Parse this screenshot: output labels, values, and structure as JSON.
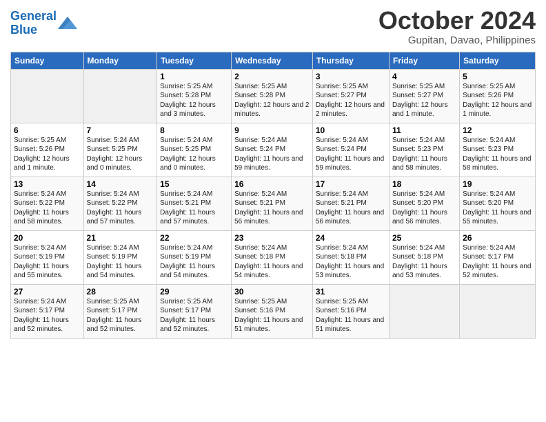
{
  "logo": {
    "line1": "General",
    "line2": "Blue"
  },
  "title": "October 2024",
  "subtitle": "Gupitan, Davao, Philippines",
  "days_of_week": [
    "Sunday",
    "Monday",
    "Tuesday",
    "Wednesday",
    "Thursday",
    "Friday",
    "Saturday"
  ],
  "weeks": [
    [
      {
        "day": "",
        "info": ""
      },
      {
        "day": "",
        "info": ""
      },
      {
        "day": "1",
        "info": "Sunrise: 5:25 AM\nSunset: 5:28 PM\nDaylight: 12 hours and 3 minutes."
      },
      {
        "day": "2",
        "info": "Sunrise: 5:25 AM\nSunset: 5:28 PM\nDaylight: 12 hours and 2 minutes."
      },
      {
        "day": "3",
        "info": "Sunrise: 5:25 AM\nSunset: 5:27 PM\nDaylight: 12 hours and 2 minutes."
      },
      {
        "day": "4",
        "info": "Sunrise: 5:25 AM\nSunset: 5:27 PM\nDaylight: 12 hours and 1 minute."
      },
      {
        "day": "5",
        "info": "Sunrise: 5:25 AM\nSunset: 5:26 PM\nDaylight: 12 hours and 1 minute."
      }
    ],
    [
      {
        "day": "6",
        "info": "Sunrise: 5:25 AM\nSunset: 5:26 PM\nDaylight: 12 hours and 1 minute."
      },
      {
        "day": "7",
        "info": "Sunrise: 5:24 AM\nSunset: 5:25 PM\nDaylight: 12 hours and 0 minutes."
      },
      {
        "day": "8",
        "info": "Sunrise: 5:24 AM\nSunset: 5:25 PM\nDaylight: 12 hours and 0 minutes."
      },
      {
        "day": "9",
        "info": "Sunrise: 5:24 AM\nSunset: 5:24 PM\nDaylight: 11 hours and 59 minutes."
      },
      {
        "day": "10",
        "info": "Sunrise: 5:24 AM\nSunset: 5:24 PM\nDaylight: 11 hours and 59 minutes."
      },
      {
        "day": "11",
        "info": "Sunrise: 5:24 AM\nSunset: 5:23 PM\nDaylight: 11 hours and 58 minutes."
      },
      {
        "day": "12",
        "info": "Sunrise: 5:24 AM\nSunset: 5:23 PM\nDaylight: 11 hours and 58 minutes."
      }
    ],
    [
      {
        "day": "13",
        "info": "Sunrise: 5:24 AM\nSunset: 5:22 PM\nDaylight: 11 hours and 58 minutes."
      },
      {
        "day": "14",
        "info": "Sunrise: 5:24 AM\nSunset: 5:22 PM\nDaylight: 11 hours and 57 minutes."
      },
      {
        "day": "15",
        "info": "Sunrise: 5:24 AM\nSunset: 5:21 PM\nDaylight: 11 hours and 57 minutes."
      },
      {
        "day": "16",
        "info": "Sunrise: 5:24 AM\nSunset: 5:21 PM\nDaylight: 11 hours and 56 minutes."
      },
      {
        "day": "17",
        "info": "Sunrise: 5:24 AM\nSunset: 5:21 PM\nDaylight: 11 hours and 56 minutes."
      },
      {
        "day": "18",
        "info": "Sunrise: 5:24 AM\nSunset: 5:20 PM\nDaylight: 11 hours and 56 minutes."
      },
      {
        "day": "19",
        "info": "Sunrise: 5:24 AM\nSunset: 5:20 PM\nDaylight: 11 hours and 55 minutes."
      }
    ],
    [
      {
        "day": "20",
        "info": "Sunrise: 5:24 AM\nSunset: 5:19 PM\nDaylight: 11 hours and 55 minutes."
      },
      {
        "day": "21",
        "info": "Sunrise: 5:24 AM\nSunset: 5:19 PM\nDaylight: 11 hours and 54 minutes."
      },
      {
        "day": "22",
        "info": "Sunrise: 5:24 AM\nSunset: 5:19 PM\nDaylight: 11 hours and 54 minutes."
      },
      {
        "day": "23",
        "info": "Sunrise: 5:24 AM\nSunset: 5:18 PM\nDaylight: 11 hours and 54 minutes."
      },
      {
        "day": "24",
        "info": "Sunrise: 5:24 AM\nSunset: 5:18 PM\nDaylight: 11 hours and 53 minutes."
      },
      {
        "day": "25",
        "info": "Sunrise: 5:24 AM\nSunset: 5:18 PM\nDaylight: 11 hours and 53 minutes."
      },
      {
        "day": "26",
        "info": "Sunrise: 5:24 AM\nSunset: 5:17 PM\nDaylight: 11 hours and 52 minutes."
      }
    ],
    [
      {
        "day": "27",
        "info": "Sunrise: 5:24 AM\nSunset: 5:17 PM\nDaylight: 11 hours and 52 minutes."
      },
      {
        "day": "28",
        "info": "Sunrise: 5:25 AM\nSunset: 5:17 PM\nDaylight: 11 hours and 52 minutes."
      },
      {
        "day": "29",
        "info": "Sunrise: 5:25 AM\nSunset: 5:17 PM\nDaylight: 11 hours and 52 minutes."
      },
      {
        "day": "30",
        "info": "Sunrise: 5:25 AM\nSunset: 5:16 PM\nDaylight: 11 hours and 51 minutes."
      },
      {
        "day": "31",
        "info": "Sunrise: 5:25 AM\nSunset: 5:16 PM\nDaylight: 11 hours and 51 minutes."
      },
      {
        "day": "",
        "info": ""
      },
      {
        "day": "",
        "info": ""
      }
    ]
  ]
}
